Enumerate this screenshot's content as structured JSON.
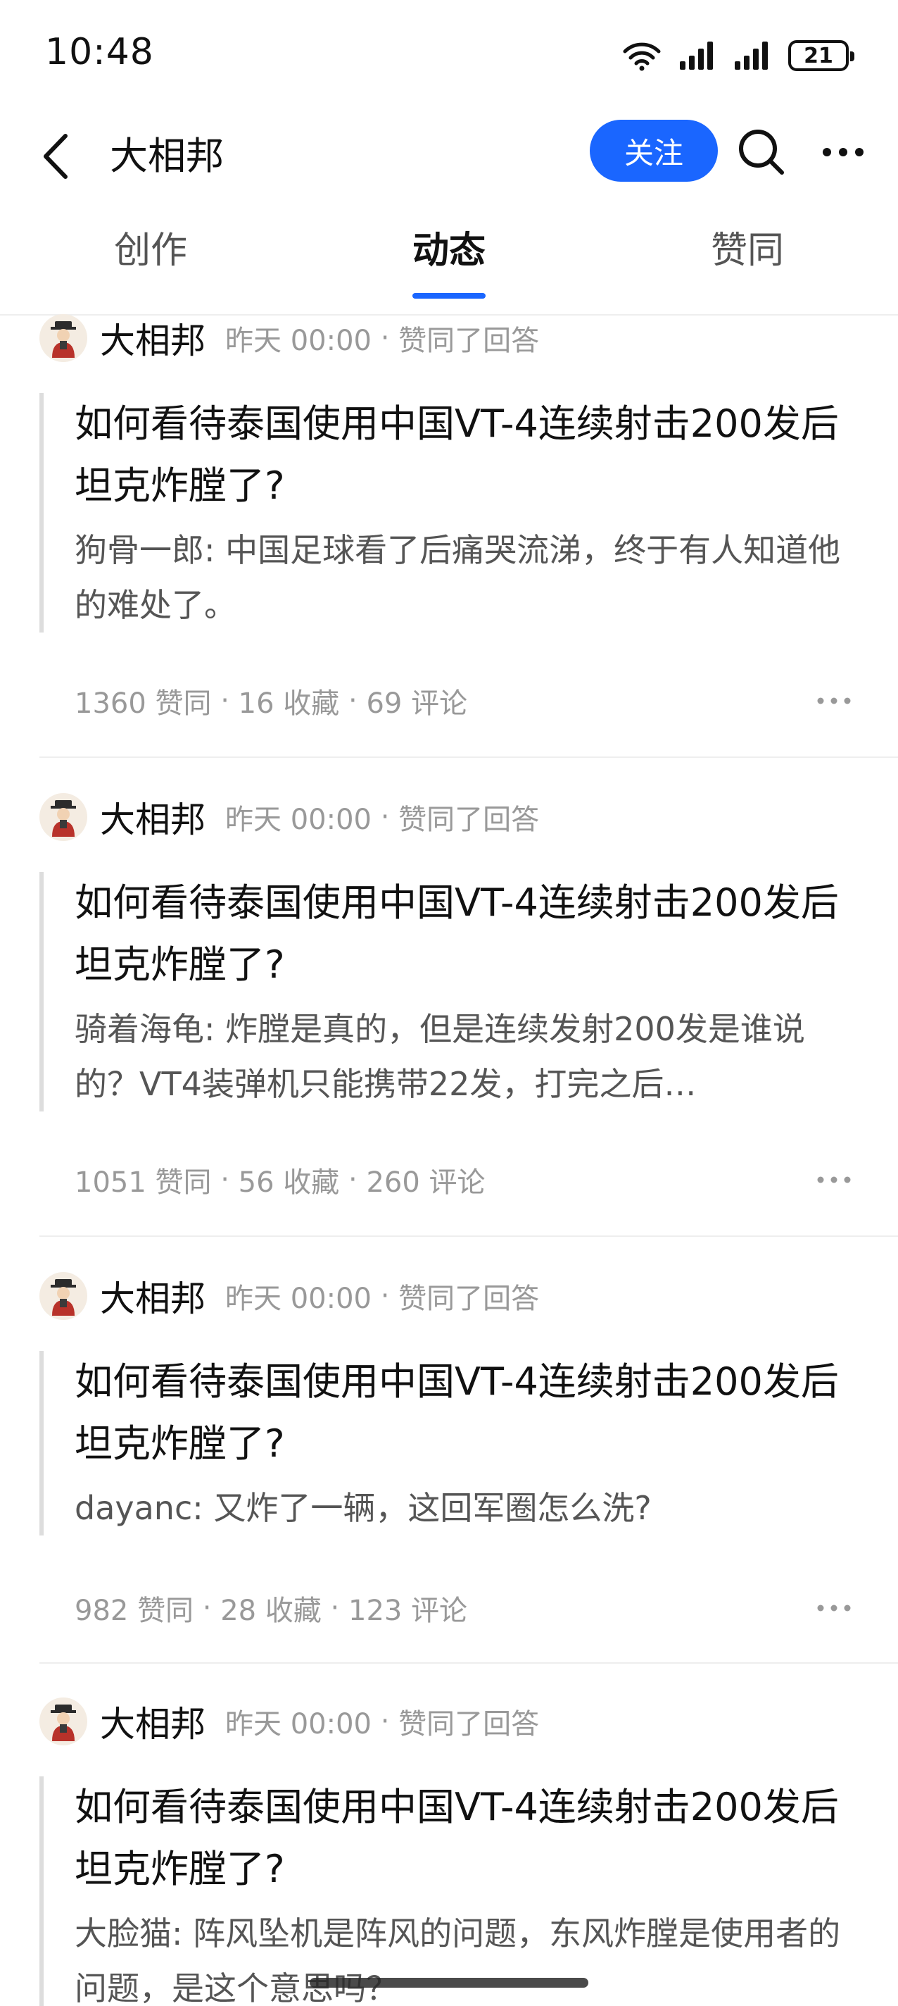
{
  "status_bar": {
    "time": "10:48",
    "battery": "21",
    "icons": [
      "wifi-icon",
      "signal-icon",
      "signal-icon",
      "battery-icon"
    ]
  },
  "header": {
    "title": "大相邦",
    "follow_label": "关注",
    "icons": [
      "back-chevron-icon",
      "search-icon",
      "more-icon"
    ],
    "accent_color": "#1a66ff"
  },
  "tabs": [
    {
      "label": "创作",
      "active": false
    },
    {
      "label": "动态",
      "active": true
    },
    {
      "label": "赞同",
      "active": false
    }
  ],
  "feed": [
    {
      "author": "大相邦",
      "time": "昨天 00:00",
      "action": "赞同了回答",
      "question": "如何看待泰国使用中国VT-4连续射击200发后坦克炸膛了?",
      "excerpt": "狗骨一郎: 中国足球看了后痛哭流涕，终于有人知道他的难处了。",
      "likes": "1360 赞同",
      "favorites": "16 收藏",
      "comments": "69 评论"
    },
    {
      "author": "大相邦",
      "time": "昨天 00:00",
      "action": "赞同了回答",
      "question": "如何看待泰国使用中国VT-4连续射击200发后坦克炸膛了?",
      "excerpt": "骑着海龟: 炸膛是真的，但是连续发射200发是谁说的？VT4装弹机只能携带22发，打完之后…",
      "likes": "1051 赞同",
      "favorites": "56 收藏",
      "comments": "260 评论"
    },
    {
      "author": "大相邦",
      "time": "昨天 00:00",
      "action": "赞同了回答",
      "question": "如何看待泰国使用中国VT-4连续射击200发后坦克炸膛了?",
      "excerpt": "dayanc: 又炸了一辆，这回军圈怎么洗?",
      "likes": "982 赞同",
      "favorites": "28 收藏",
      "comments": "123 评论"
    },
    {
      "author": "大相邦",
      "time": "昨天 00:00",
      "action": "赞同了回答",
      "question": "如何看待泰国使用中国VT-4连续射击200发后坦克炸膛了?",
      "excerpt": "大脸猫: 阵风坠机是阵风的问题，东风炸膛是使用者的问题，是这个意思吗？",
      "likes": "",
      "favorites": "",
      "comments": ""
    }
  ]
}
